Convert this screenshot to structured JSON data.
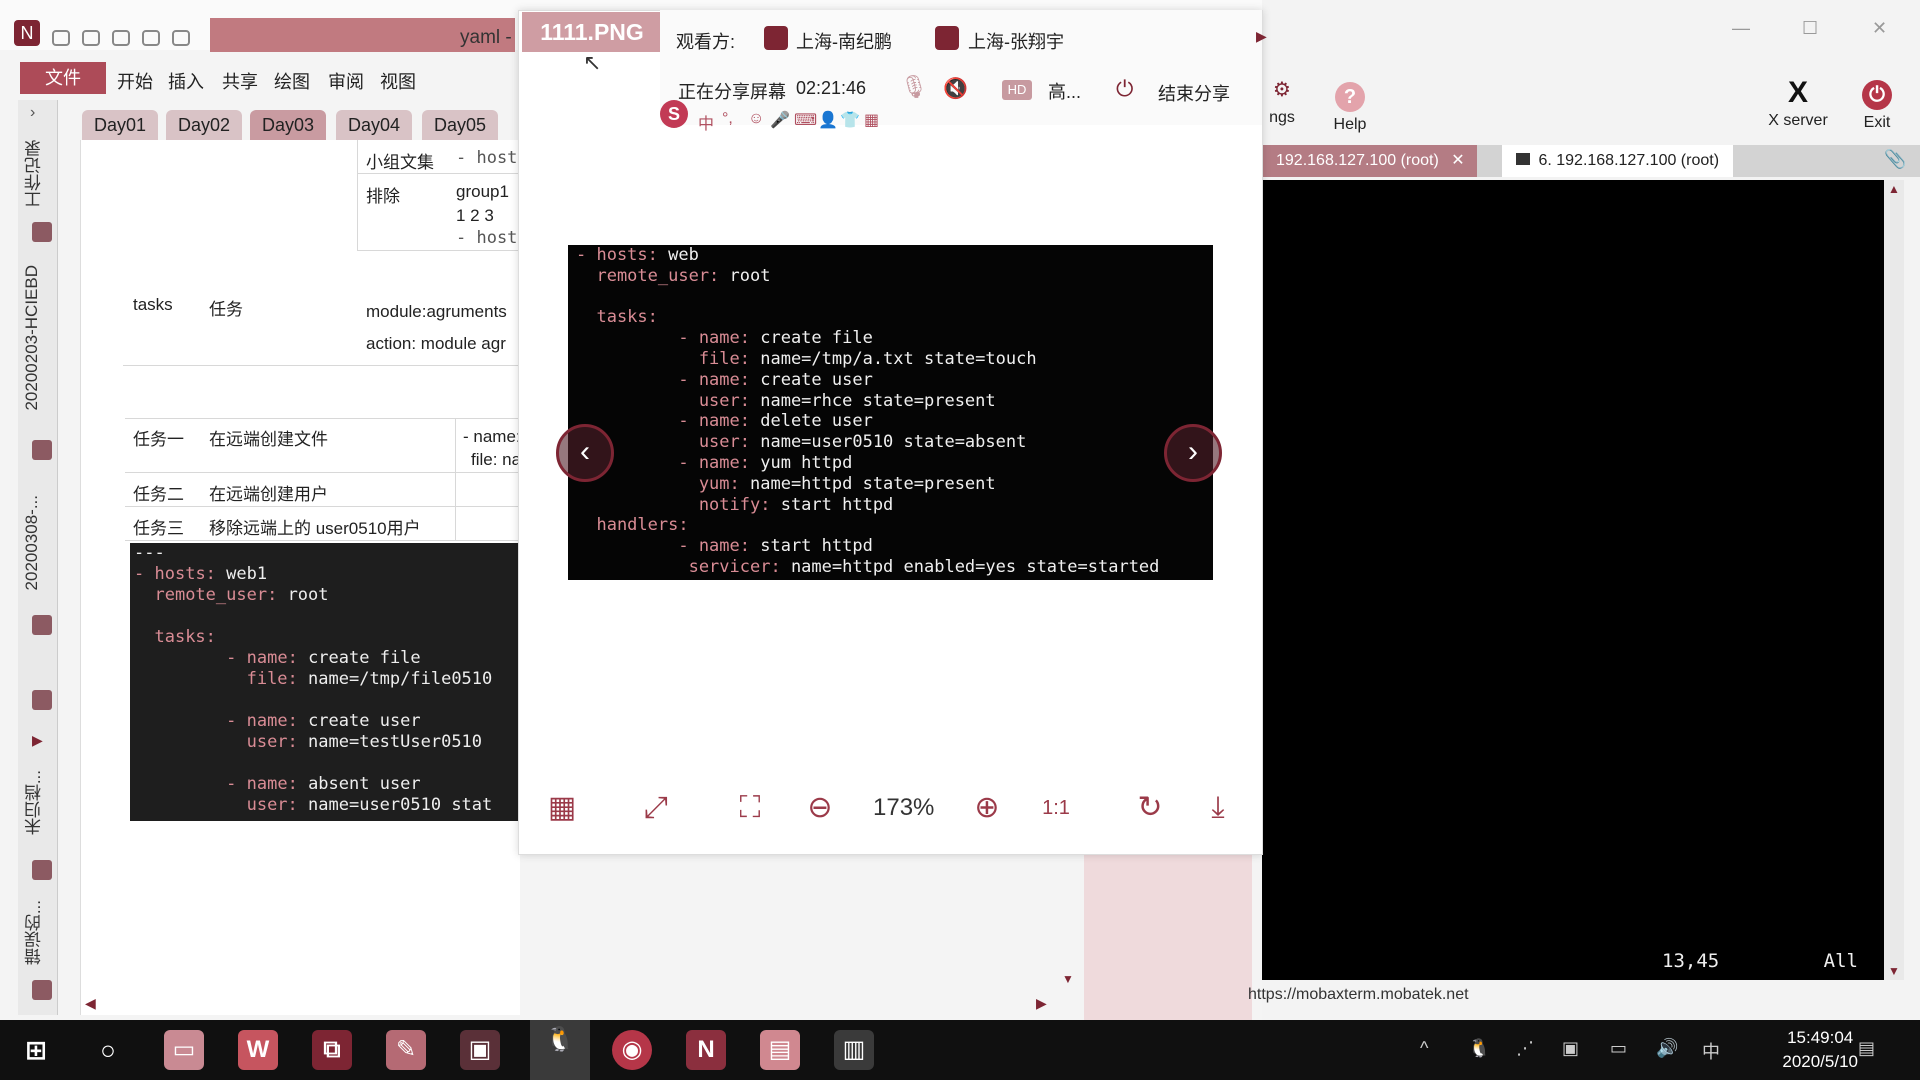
{
  "onenote": {
    "title": "yaml -",
    "menu": [
      "文件",
      "开始",
      "插入",
      "共享",
      "绘图",
      "审阅",
      "视图"
    ],
    "sidebar_labels": [
      "工作记录",
      "20200203-HCIEBD",
      "20200308-...",
      "未归档...",
      "错误的..."
    ],
    "tabs": [
      "Day01",
      "Day02",
      "Day03",
      "Day04",
      "Day05"
    ],
    "table": {
      "r1c1": "小组文集",
      "r1c2": "- hosts",
      "r2c1": "排除",
      "r2c2": "group1",
      "r2c3": "1 2 3",
      "r2c4": "- hosts",
      "tasks_en": "tasks",
      "tasks_cn": "任务",
      "module": "module:agruments",
      "action": "action:  module agr",
      "t1_label": "任务一",
      "t1_desc": "在远端创建文件",
      "t1_code_a": "- name:",
      "t1_code_b": "file: na",
      "t2_label": "任务二",
      "t2_desc": "在远端创建用户",
      "t3_label": "任务三",
      "t3_desc": "移除远端上的 user0510用户"
    },
    "code": {
      "l0": "---",
      "l1_dash": "-",
      "l1_key": "hosts:",
      "l1_val": "web1",
      "l2_key": "remote_user:",
      "l2_val": "root",
      "l3_key": "tasks:",
      "l4_key": "name:",
      "l4_val": "create file",
      "l5_key": "file:",
      "l5_val": "name=/tmp/file0510",
      "l6_key": "name:",
      "l6_val": "create user",
      "l7_key": "user:",
      "l7_val": "name=testUser0510",
      "l8_key": "name:",
      "l8_val": "absent user",
      "l9_key": "user:",
      "l9_val": "name=user0510 stat"
    }
  },
  "viewer": {
    "title": "1111.PNG",
    "share": {
      "viewers_label": "观看方:",
      "viewer1": "上海-南纪鹏",
      "viewer2": "上海-张翔宇",
      "status": "正在分享屏幕",
      "time": "02:21:46",
      "hd": "HD",
      "quality": "高...",
      "end": "结束分享"
    },
    "ime_chars": [
      "中"
    ],
    "image_code": {
      "l0k": "- hosts:",
      "l0v": " web",
      "l1k": "  remote_user:",
      "l1v": " root",
      "l2k": "  tasks:",
      "l3k": "          - name:",
      "l3v": " create file",
      "l4k": "            file:",
      "l4v": " name=/tmp/a.txt state=touch",
      "l5k": "          - name:",
      "l5v": " create user",
      "l6k": "            user:",
      "l6v": " name=rhce state=present",
      "l7k": "          - name:",
      "l7v": " delete user",
      "l8k": "            user:",
      "l8v": " name=user0510 state=absent",
      "l9k": "          - name:",
      "l9v": " yum httpd",
      "l10k": "            yum:",
      "l10v": " name=httpd state=present",
      "l11k": "            notify:",
      "l11v": " start httpd",
      "l12k": "  handlers:",
      "l13k": "          - name:",
      "l13v": " start httpd",
      "l14k": "           servicer:",
      "l14v": " name=httpd enabled=yes state=started"
    },
    "zoom": "173%"
  },
  "moba": {
    "btn_settings": "ngs",
    "btn_help": "Help",
    "btn_xserver": "X server",
    "btn_exit": "Exit",
    "tab1": "192.168.127.100 (root)",
    "tab2": "6. 192.168.127.100 (root)",
    "cursor_pos": "13,45",
    "scroll_pos": "All",
    "status_url": "https://mobaxterm.mobatek.net"
  },
  "taskbar": {
    "time": "15:49:04",
    "date": "2020/5/10",
    "ime": "中"
  }
}
